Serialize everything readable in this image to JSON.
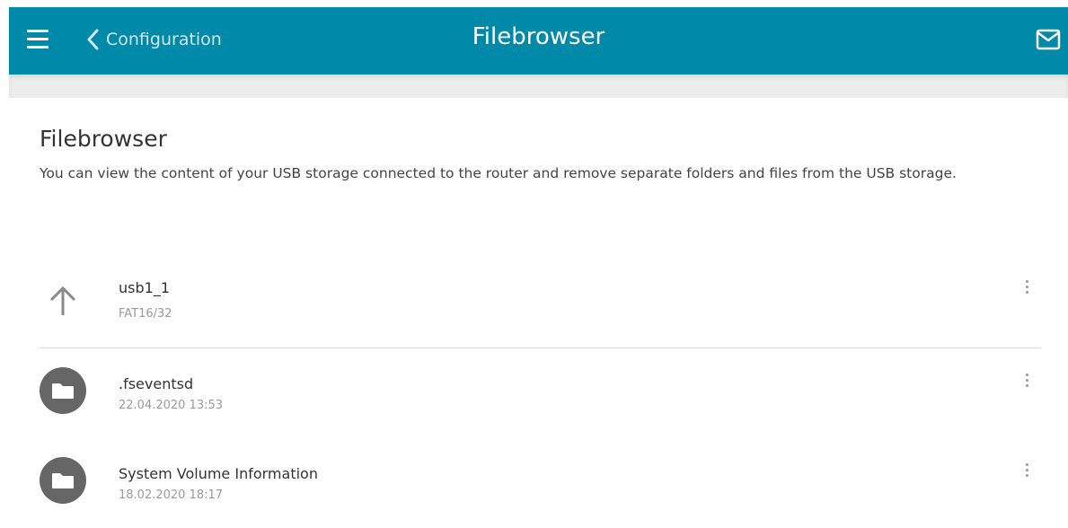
{
  "header": {
    "back_label": "Configuration",
    "title": "Filebrowser",
    "color": "#0089a8"
  },
  "icons": {
    "menu": "hamburger-icon",
    "back": "chevron-left-icon",
    "mail": "mail-icon",
    "up": "arrow-up-icon",
    "folder": "folder-icon",
    "more": "more-vertical-icon"
  },
  "section": {
    "title": "Filebrowser",
    "description": "You can view the content of your USB storage connected to the router and remove separate folders and files from the USB storage."
  },
  "storage": {
    "name": "usb1_1",
    "filesystem": "FAT16/32"
  },
  "files": [
    {
      "name": ".fseventsd",
      "date": "22.04.2020 13:53"
    },
    {
      "name": "System Volume Information",
      "date": "18.02.2020 18:17"
    }
  ]
}
